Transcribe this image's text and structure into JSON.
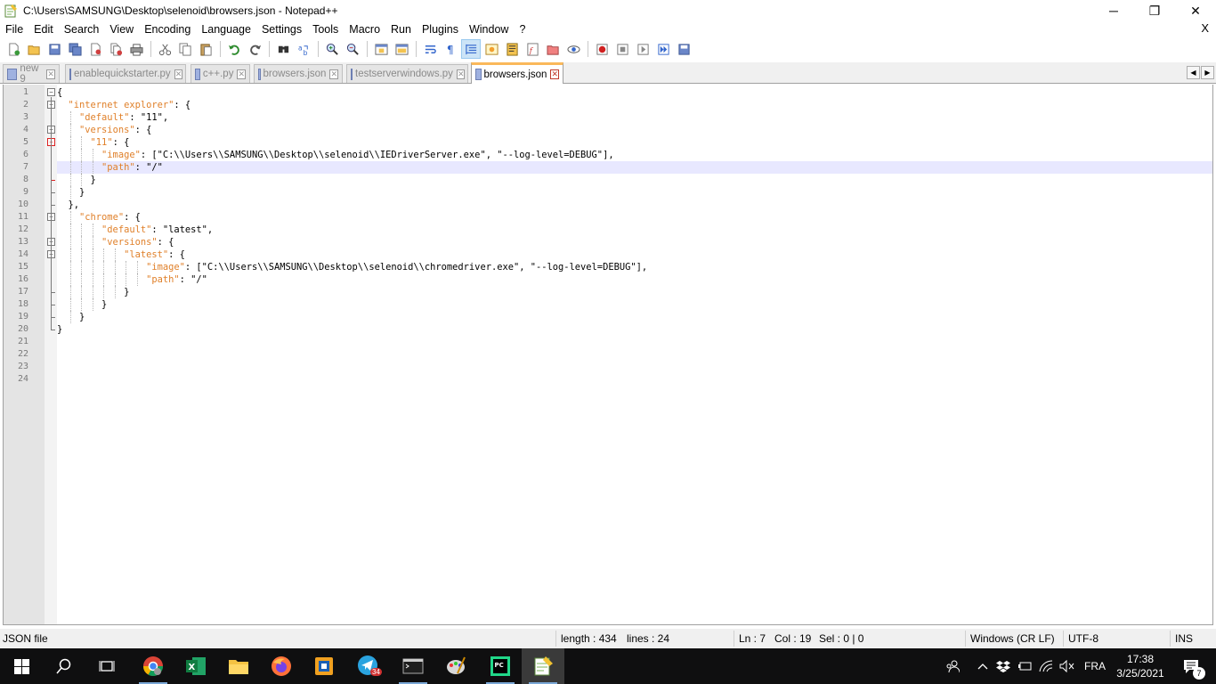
{
  "window": {
    "title": "C:\\Users\\SAMSUNG\\Desktop\\selenoid\\browsers.json - Notepad++",
    "minimize_label": "─",
    "restore_label": "❐",
    "close_label": "✕"
  },
  "menu": {
    "items": [
      "File",
      "Edit",
      "Search",
      "View",
      "Encoding",
      "Language",
      "Settings",
      "Tools",
      "Macro",
      "Run",
      "Plugins",
      "Window",
      "?"
    ],
    "close_label": "X"
  },
  "tabs": [
    {
      "label": "new 9",
      "active": false
    },
    {
      "label": "enablequickstarter.py",
      "active": false
    },
    {
      "label": "c++.py",
      "active": false
    },
    {
      "label": "browsers.json",
      "active": false
    },
    {
      "label": "testserverwindows.py",
      "active": false
    },
    {
      "label": "browsers.json",
      "active": true
    }
  ],
  "tab_close_label": "✕",
  "tab_scroll": {
    "left": "◀",
    "right": "▶"
  },
  "editor": {
    "current_line": 7,
    "line_numbers": [
      "1",
      "2",
      "3",
      "4",
      "5",
      "6",
      "7",
      "8",
      "9",
      "10",
      "11",
      "12",
      "13",
      "14",
      "15",
      "16",
      "17",
      "18",
      "19",
      "20",
      "21",
      "22",
      "23",
      "24"
    ],
    "lines": [
      "{",
      "  \"internet explorer\": {",
      "    \"default\": \"11\",",
      "    \"versions\": {",
      "      \"11\": {",
      "        \"image\": [\"C:\\\\Users\\\\SAMSUNG\\\\Desktop\\\\selenoid\\\\IEDriverServer.exe\", \"--log-level=DEBUG\"],",
      "        \"path\": \"/\"",
      "      }",
      "    }",
      "  },",
      "    \"chrome\": {",
      "        \"default\": \"latest\",",
      "        \"versions\": {",
      "            \"latest\": {",
      "                \"image\": [\"C:\\\\Users\\\\SAMSUNG\\\\Desktop\\\\selenoid\\\\chromedriver.exe\", \"--log-level=DEBUG\"],",
      "                \"path\": \"/\"",
      "            }",
      "        }",
      "    }",
      "}",
      "",
      "",
      "",
      ""
    ]
  },
  "status": {
    "file_type": "JSON file",
    "length": "length : 434",
    "lines": "lines : 24",
    "ln": "Ln : 7",
    "col": "Col : 19",
    "sel": "Sel : 0 | 0",
    "eol": "Windows (CR LF)",
    "encoding": "UTF-8",
    "mode": "INS"
  },
  "taskbar": {
    "telegram_badge": "34",
    "language": "FRA",
    "time": "17:38",
    "date": "3/25/2021",
    "notification_count": "7"
  },
  "colors": {
    "json_key": "#e0802a",
    "current_line_bg": "#e8e8ff",
    "active_tab_accent": "#fab85a",
    "taskbar_bg": "#0f0f10"
  }
}
